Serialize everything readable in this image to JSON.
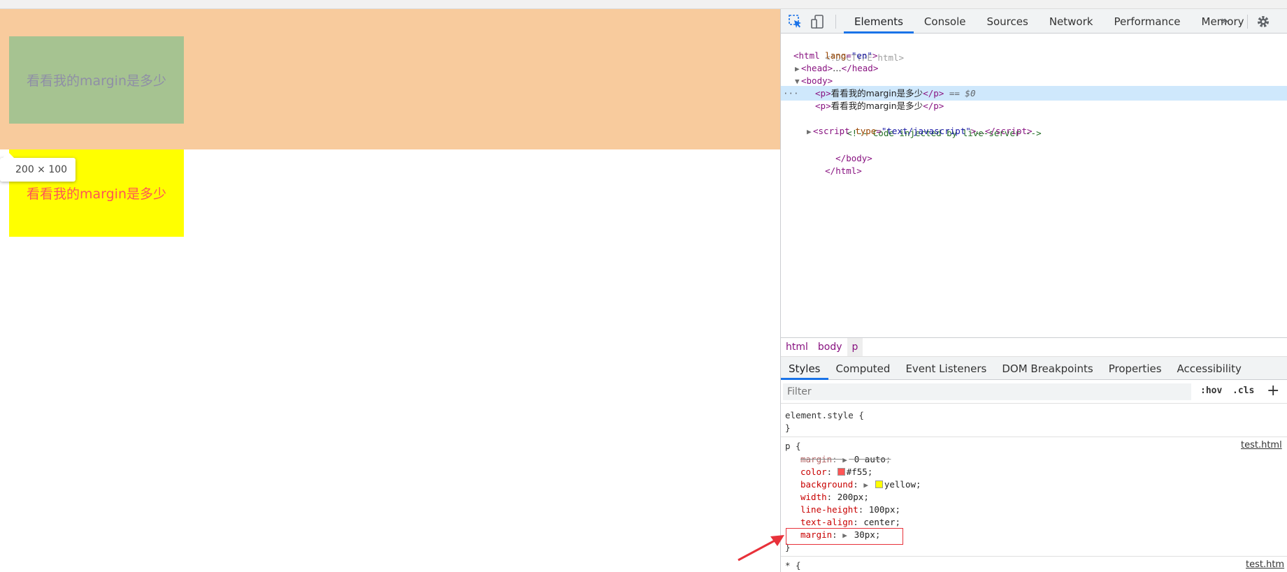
{
  "page": {
    "p1_text": "看看我的margin是多少",
    "p2_text": "看看我的margin是多少",
    "size_tooltip": "200 × 100"
  },
  "devtools": {
    "tabs": [
      "Elements",
      "Console",
      "Sources",
      "Network",
      "Performance",
      "Memory"
    ],
    "active_tab": "Elements",
    "dom": {
      "doctype": "<!DOCTYPE html>",
      "html_open_tag": "html",
      "html_attr_name": "lang",
      "html_attr_value": "\"en\"",
      "head_tag": "head",
      "head_ellipsis": "…",
      "body_tag": "body",
      "p_tag": "p",
      "p1_text": "看看我的margin是多少",
      "selected_marker": "== $0",
      "p2_text": "看看我的margin是多少",
      "comment": "<!-- Code injected by live-server -->",
      "script_tag": "script",
      "script_attr_name": "type",
      "script_attr_value": "\"text/javascript\"",
      "script_ellipsis": "…",
      "body_close": "</body>",
      "html_close": "</html>",
      "dots": "···"
    },
    "breadcrumbs": [
      "html",
      "body",
      "p"
    ],
    "sub_tabs": [
      "Styles",
      "Computed",
      "Event Listeners",
      "DOM Breakpoints",
      "Properties",
      "Accessibility"
    ],
    "active_sub_tab": "Styles",
    "filter_placeholder": "Filter",
    "hov_label": ":hov",
    "cls_label": ".cls",
    "plus_label": "+",
    "styles": {
      "element_style_selector": "element.style {",
      "element_style_close": "}",
      "rule_selector": "p {",
      "rule_source": "test.html",
      "rule_close": "}",
      "declarations": [
        {
          "name": "margin",
          "value": "0 auto",
          "overridden": true,
          "expandable": true
        },
        {
          "name": "color",
          "value": "#f55",
          "swatch": "#ff5555"
        },
        {
          "name": "background",
          "value": "yellow",
          "swatch": "#ffff00",
          "expandable": true
        },
        {
          "name": "width",
          "value": "200px"
        },
        {
          "name": "line-height",
          "value": "100px"
        },
        {
          "name": "text-align",
          "value": "center"
        },
        {
          "name": "margin",
          "value": "30px",
          "expandable": true
        }
      ],
      "universal_selector": "* {",
      "universal_source": "test.htm"
    }
  },
  "colors": {
    "margin_overlay": "#f8cb9d",
    "content_highlight": "#a6c391",
    "accent": "#1a73e8",
    "annotation_red": "#e8313a"
  }
}
